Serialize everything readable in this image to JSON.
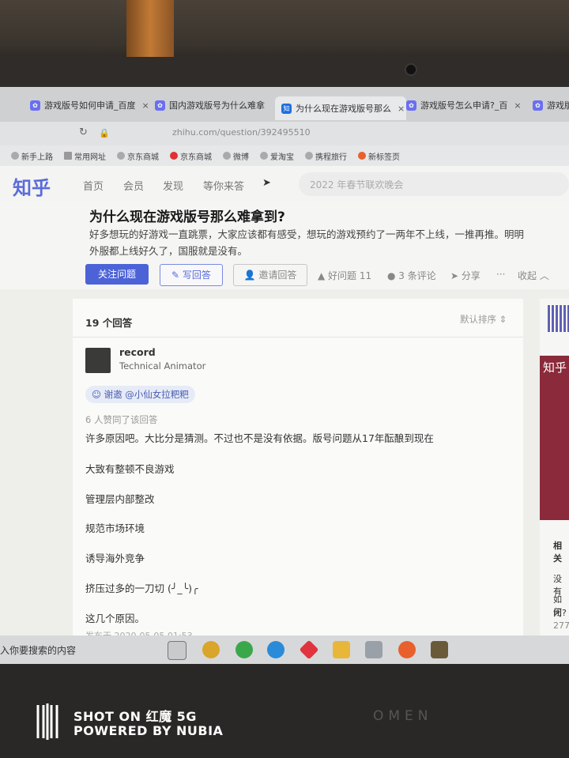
{
  "browser": {
    "tabs": [
      {
        "title": "游戏版号如何申请_百度",
        "close": "×"
      },
      {
        "title": "国内游戏版号为什么难拿",
        "close": "×"
      },
      {
        "title": "为什么现在游戏版号那么",
        "close": "×"
      },
      {
        "title": "游戏版号怎么申请?_百",
        "close": "×"
      },
      {
        "title": "游戏版",
        "close": ""
      }
    ],
    "address": "zhihu.com/question/392495510",
    "bookmarks": [
      "新手上路",
      "常用网址",
      "京东商城",
      "京东商城",
      "微博",
      "爱淘宝",
      "携程旅行",
      "新标签页"
    ]
  },
  "zhihu_nav": {
    "logo": "知乎",
    "links": [
      "首页",
      "会员",
      "发现",
      "等你来答"
    ],
    "search_placeholder": "2022 年春节联欢晚会"
  },
  "question": {
    "title": "为什么现在游戏版号那么难拿到?",
    "description_line1": "好多想玩的好游戏一直跳票，大家应该都有感受，想玩的游戏预约了一两年不上线，一推再推。明明",
    "description_line2": "外服都上线好久了，国服就是没有。",
    "follow_button": "关注问题",
    "write_button": "写回答",
    "invite_button": "邀请回答",
    "good_question": "好问题 11",
    "comments": "3 条评论",
    "share": "分享",
    "more": "···",
    "collapse": "收起"
  },
  "answers": {
    "count_label": "19 个回答",
    "sort_label": "默认排序",
    "author_name": "record",
    "author_title": "Technical Animator",
    "invited_tag": "谢邀 @小仙女拉粑粑",
    "upvote_text": "6 人赞同了该回答",
    "paragraphs": [
      "许多原因吧。大比分是猜测。不过也不是没有依据。版号问题从17年酝酿到现在",
      "大致有整顿不良游戏",
      "管理层内部整改",
      "规范市场环境",
      "诱导海外竞争",
      "挤压过多的一刀切 (╯_╰)╭",
      "这几个原因。"
    ],
    "date_partial": "发布于 2020-05-05 01:53"
  },
  "sidebar": {
    "banner_text": "知乎",
    "related": "相关",
    "no": "没有",
    "q1": "如何",
    "q2": "闭?",
    "num": "277"
  },
  "taskbar": {
    "search_text": "入你要搜索的内容"
  },
  "photo": {
    "shot_on": "SHOT ON 红魔 5G",
    "powered_by": "POWERED BY NUBIA",
    "brand": "OMEN"
  }
}
